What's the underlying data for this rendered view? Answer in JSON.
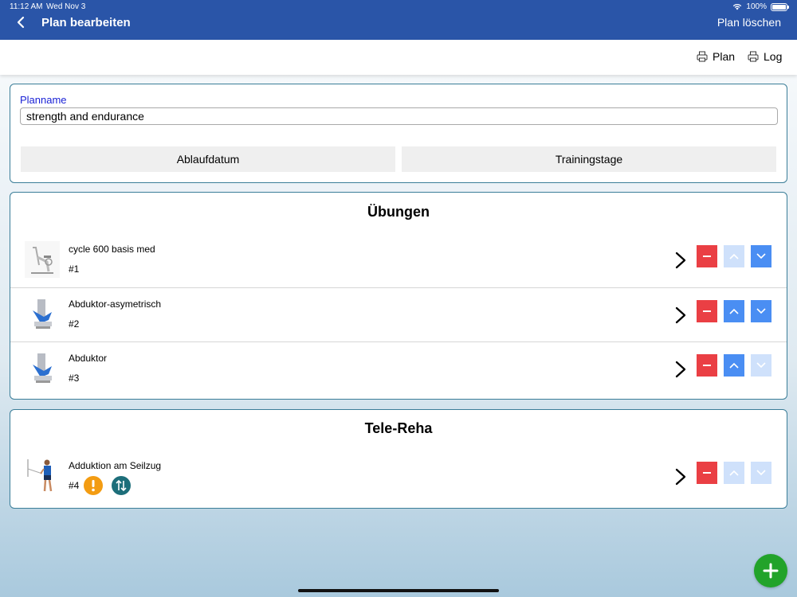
{
  "status_bar": {
    "time": "11:12 AM",
    "date": "Wed Nov 3",
    "battery": "100%"
  },
  "header": {
    "title": "Plan bearbeiten",
    "delete_label": "Plan löschen",
    "color": "#2a55a8"
  },
  "toolbar": {
    "plan_label": "Plan",
    "log_label": "Log",
    "icon": "printer-icon"
  },
  "plan_form": {
    "name_label": "Planname",
    "name_value": "strength and endurance",
    "expiry_button": "Ablaufdatum",
    "days_button": "Trainingstage"
  },
  "exercises": {
    "title": "Übungen",
    "items": [
      {
        "name": "cycle 600 basis med",
        "number": "#1",
        "icon": "cycle-machine-icon",
        "up_enabled": false,
        "down_enabled": true
      },
      {
        "name": "Abduktor-asymetrisch",
        "number": "#2",
        "icon": "abductor-machine-icon",
        "up_enabled": true,
        "down_enabled": true
      },
      {
        "name": "Abduktor",
        "number": "#3",
        "icon": "abductor-machine-icon",
        "up_enabled": true,
        "down_enabled": false
      }
    ]
  },
  "tele_reha": {
    "title": "Tele-Reha",
    "items": [
      {
        "name": "Adduktion am Seilzug",
        "number": "#4",
        "icon": "cable-exercise-icon",
        "badges": [
          "warning-icon",
          "swap-vertical-icon"
        ],
        "up_enabled": false,
        "down_enabled": false
      }
    ]
  },
  "colors": {
    "minus": "#ea3f44",
    "move_active": "#4a8ef3",
    "move_disabled": "#cfe1fb",
    "fab": "#22a32a",
    "warning_badge": "#f39c12",
    "swap_badge": "#1d6e7a"
  }
}
